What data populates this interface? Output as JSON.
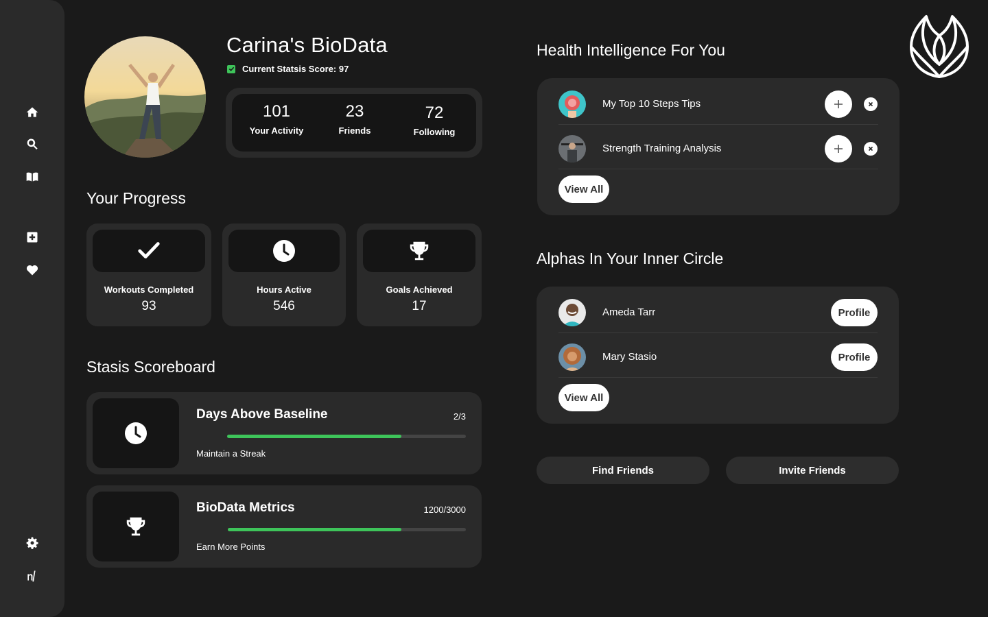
{
  "profile": {
    "title": "Carina's BioData",
    "score_text": "Current Statsis Score: 97",
    "stats": [
      {
        "value": "101",
        "label": "Your Activity"
      },
      {
        "value": "23",
        "label": "Friends"
      },
      {
        "value": "72",
        "label": "Following"
      }
    ]
  },
  "sidebar": {
    "icons": [
      "home-icon",
      "search-icon",
      "book-icon",
      "add-icon",
      "heart-icon",
      "gear-icon",
      "logo-mark-icon"
    ]
  },
  "progress": {
    "heading": "Your Progress",
    "cards": [
      {
        "icon": "check-icon",
        "label": "Workouts Completed",
        "value": "93"
      },
      {
        "icon": "clock-icon",
        "label": "Hours Active",
        "value": "546"
      },
      {
        "icon": "trophy-icon",
        "label": "Goals Achieved",
        "value": "17"
      }
    ]
  },
  "scoreboard": {
    "heading": "Stasis Scoreboard",
    "items": [
      {
        "icon": "clock-icon",
        "name": "Days Above Baseline",
        "ratio": "2/3",
        "progress": 0.73,
        "sub": "Maintain a Streak"
      },
      {
        "icon": "trophy-icon",
        "name": "BioData Metrics",
        "ratio": "1200/3000",
        "progress": 0.73,
        "sub": "Earn More Points"
      }
    ]
  },
  "health": {
    "heading": "Health Intelligence For You",
    "items": [
      {
        "name": "My Top 10 Steps Tips"
      },
      {
        "name": "Strength Training Analysis"
      }
    ],
    "view_all": "View All"
  },
  "circle": {
    "heading": "Alphas In Your Inner Circle",
    "members": [
      {
        "name": "Ameda Tarr",
        "action": "Profile"
      },
      {
        "name": "Mary Stasio",
        "action": "Profile"
      }
    ],
    "view_all": "View All"
  },
  "actions": {
    "find": "Find Friends",
    "invite": "Invite Friends"
  },
  "colors": {
    "accent": "#3ec45a",
    "background": "#1a1a1a",
    "panel": "#2a2a2a"
  }
}
